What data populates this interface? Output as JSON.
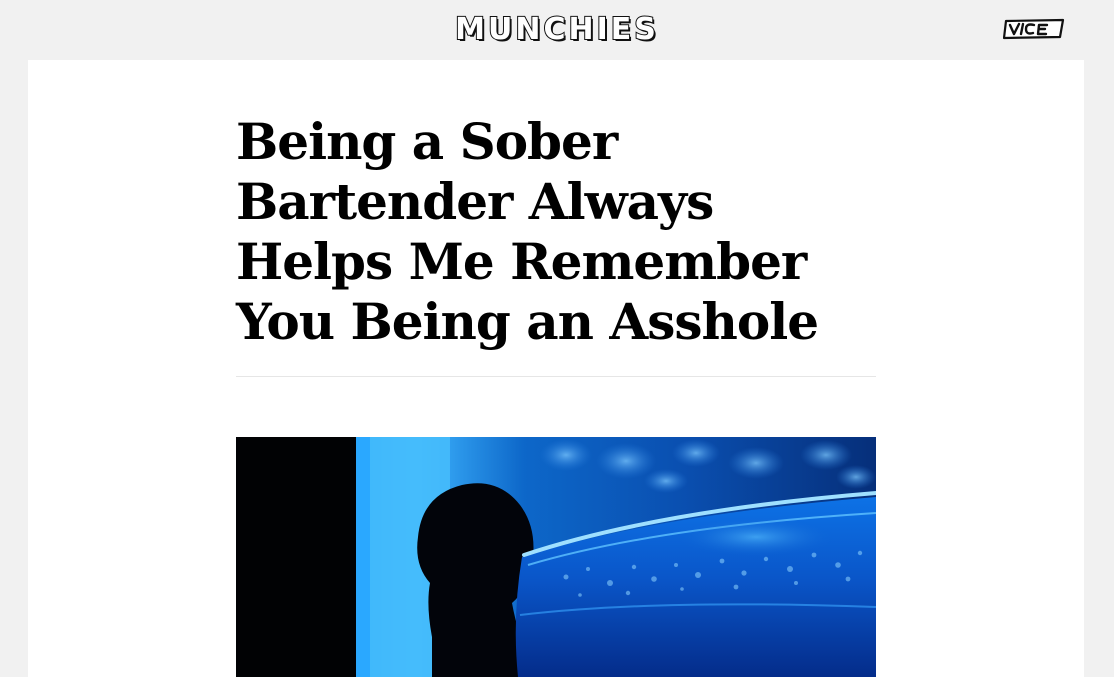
{
  "header": {
    "site_logo": "MUNCHIES",
    "network_logo": "VICE",
    "network_logo_icon": "vice-logo-icon"
  },
  "article": {
    "headline": "Being a Sober Bartender Always Helps Me Remember You Being an Asshole",
    "hero_image_icon": "cocktail-glass-photo"
  },
  "colors": {
    "page_background": "#f1f1f1",
    "card_background": "#ffffff",
    "headline_text": "#000000",
    "divider": "#e6e6e6",
    "hero_blue": "#0a5ec8"
  }
}
